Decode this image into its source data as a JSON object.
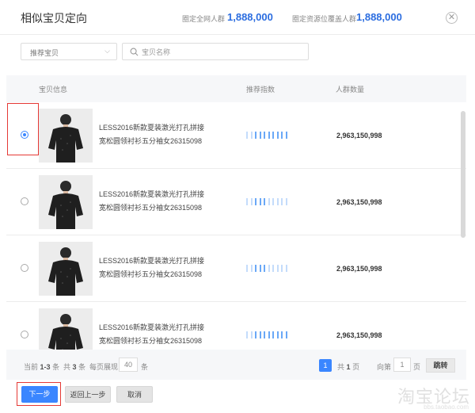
{
  "header": {
    "title": "相似宝贝定向",
    "stat1_label": "圈定全网人群",
    "stat1_value": "1,888,000",
    "stat2_label": "圈定资源位覆盖人群",
    "stat2_value": "1,888,000",
    "close_icon": "close-circle-icon"
  },
  "filters": {
    "select_value": "推荐宝贝",
    "search_placeholder": "宝贝名称",
    "search_value": ""
  },
  "table": {
    "headers": [
      "宝贝信息",
      "推荐指数",
      "人群数量"
    ],
    "rows": [
      {
        "selected": true,
        "name_line1": "LESS2016新款夏装激光打孔拼接",
        "name_line2": "宽松圆领衬衫五分袖女26315098",
        "recommend_level": 10,
        "recommend_max": 10,
        "count": "2,963,150,998"
      },
      {
        "selected": false,
        "name_line1": "LESS2016新款夏装激光打孔拼接",
        "name_line2": "宽松圆领衬衫五分袖女26315098",
        "recommend_level": 5,
        "recommend_max": 10,
        "count": "2,963,150,998"
      },
      {
        "selected": false,
        "name_line1": "LESS2016新款夏装激光打孔拼接",
        "name_line2": "宽松圆领衬衫五分袖女26315098",
        "recommend_level": 5,
        "recommend_max": 10,
        "count": "2,963,150,998"
      },
      {
        "selected": false,
        "name_line1": "LESS2016新款夏装激光打孔拼接",
        "name_line2": "宽松圆领衬衫五分袖女26315098",
        "recommend_level": 10,
        "recommend_max": 10,
        "count": "2,963,150,998"
      }
    ]
  },
  "pager": {
    "current_label": "当前",
    "current_range": "1-3",
    "items_unit": "条",
    "total_label": "共",
    "total_count": "3",
    "per_page_label": "每页展现",
    "per_page_value": "40",
    "page": "1",
    "page_total_prefix": "共",
    "page_total": "1",
    "page_unit": "页",
    "goto_label": "向第",
    "goto_value": "1",
    "goto_unit": "页",
    "jump_label": "跳转"
  },
  "footer": {
    "next_label": "下一步",
    "back_label": "返回上一步",
    "cancel_label": "取消"
  },
  "watermark": {
    "main": "淘宝论坛",
    "sub": "bbs.taobao.com"
  },
  "colors": {
    "accent": "#3a86ff",
    "stat_value": "#2b6de0",
    "highlight": "#e53935",
    "bar_active": "#6aa8f7",
    "bar_light": "#c4dcfb"
  }
}
